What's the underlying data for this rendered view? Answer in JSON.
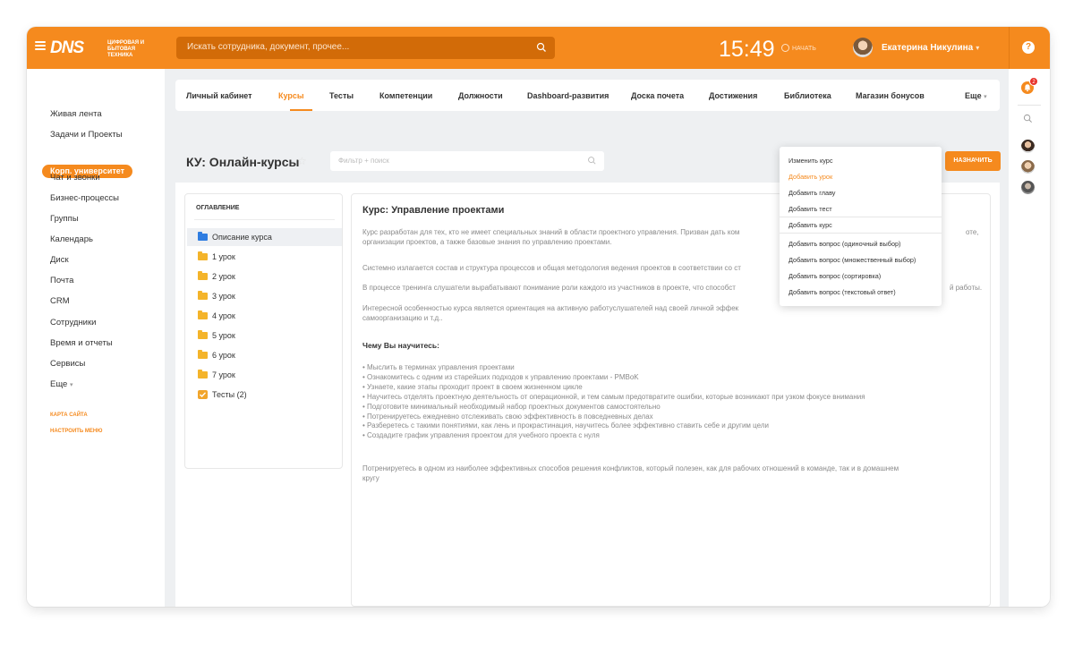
{
  "header": {
    "logo": "DNS",
    "logo_sub": "ЦИФРОВАЯ И БЫТОВАЯ ТЕХНИКА",
    "search_placeholder": "Искать сотрудника, документ, прочее...",
    "time": "15:49",
    "start_label": "НАЧАТЬ",
    "user_name": "Екатерина Никулина",
    "help_icon": "?"
  },
  "sidebar": {
    "items": [
      {
        "label": "Живая лента"
      },
      {
        "label": "Задачи и Проекты"
      },
      {
        "label": "Корп. университет"
      },
      {
        "label": "Чат и звонки"
      },
      {
        "label": "Бизнес-процессы"
      },
      {
        "label": "Группы"
      },
      {
        "label": "Календарь"
      },
      {
        "label": "Диск"
      },
      {
        "label": "Почта"
      },
      {
        "label": "CRM"
      },
      {
        "label": "Сотрудники"
      },
      {
        "label": "Время и отчеты"
      },
      {
        "label": "Сервисы"
      },
      {
        "label": "Еще"
      }
    ],
    "links": [
      "КАРТА САЙТА",
      "НАСТРОИТЬ МЕНЮ"
    ]
  },
  "right_bar": {
    "notification_count": "2"
  },
  "tabs": [
    {
      "label": "Личный кабинет"
    },
    {
      "label": "Курсы"
    },
    {
      "label": "Тесты"
    },
    {
      "label": "Компетенции"
    },
    {
      "label": "Должности"
    },
    {
      "label": "Dashboard-развития"
    },
    {
      "label": "Доска почета"
    },
    {
      "label": "Достижения"
    },
    {
      "label": "Библиотека"
    },
    {
      "label": "Магазин бонусов"
    },
    {
      "label": "Еще"
    }
  ],
  "page": {
    "title": "КУ: Онлайн-курсы",
    "filter_placeholder": "Фильтр + поиск",
    "assign_label": "НАЗНАЧИТЬ"
  },
  "toc": {
    "title": "ОГЛАВЛЕНИЕ",
    "items": [
      {
        "label": "Описание курса"
      },
      {
        "label": "1 урок"
      },
      {
        "label": "2 урок"
      },
      {
        "label": "3 урок"
      },
      {
        "label": "4 урок"
      },
      {
        "label": "5 урок"
      },
      {
        "label": "6 урок"
      },
      {
        "label": "7 урок"
      },
      {
        "label": "Тесты (2)"
      }
    ]
  },
  "course": {
    "title": "Курс: Управление проектами",
    "p1_line1": "Курс разработан для тех, кто не имеет специальных знаний в области проектного управления. Призван дать ком",
    "p1_line1_tail": "оте,",
    "p1_line2": "организации проектов, а также базовые знания по управлению проектами.",
    "p2": "Системно излагается состав и структура процессов и общая методология ведения проектов в соответствии со ст",
    "p3": "В процессе тренинга слушатели вырабатывают понимание роли каждого из участников в проекте, что способст",
    "p3_tail": "й работы.",
    "p4_line1": "Интересной особенностью курса является ориентация на активную работуслушателей над своей личной эффек",
    "p4_line2": "самоорганизацию и т.д..",
    "subhead": "Чему Вы научитесь:",
    "bullets": [
      "• Мыслить в терминах управления проектами",
      "• Ознакомитесь с одним из старейших подходов к управлению проектами - PMBoK",
      "• Узнаете, какие этапы проходит проект в своем жизненном цикле",
      "• Научитесь отделять проектную деятельность от операционной, и тем самым предотвратите ошибки, которые возникают при узком фокусе внимания",
      "• Подготовите минимальный необходимый набор проектных документов самостоятельно",
      "• Потренируетесь ежедневно отслеживать свою эффективность в повседневных делах",
      "• Разберетесь с такими понятиями, как лень и прокрастинация, научитесь более эффективно ставить себе и другим цели",
      "• Создадите график управления проектом для учебного проекта с нуля"
    ],
    "outro_line1": "Потренируетесь в одном из наиболее эффективных способов решения конфликтов, который полезен, как для рабочих отношений в команде, так и в домашнем",
    "outro_line2": "кругу"
  },
  "menu": {
    "items": [
      {
        "label": "Изменить курс"
      },
      {
        "label": "Добавить урок"
      },
      {
        "label": "Добавить главу"
      },
      {
        "label": "Добавить тест"
      },
      {
        "label": "Добавить курс"
      },
      {
        "label": "Добавить вопрос (одиночный выбор)"
      },
      {
        "label": "Добавить вопрос (множественный выбор)"
      },
      {
        "label": "Добавить вопрос (сортировка)"
      },
      {
        "label": "Добавить вопрос (текстовый ответ)"
      }
    ]
  },
  "colors": {
    "accent": "#f58a1e",
    "folder_blue": "#2f7de1",
    "folder_yellow": "#f4b42a"
  }
}
